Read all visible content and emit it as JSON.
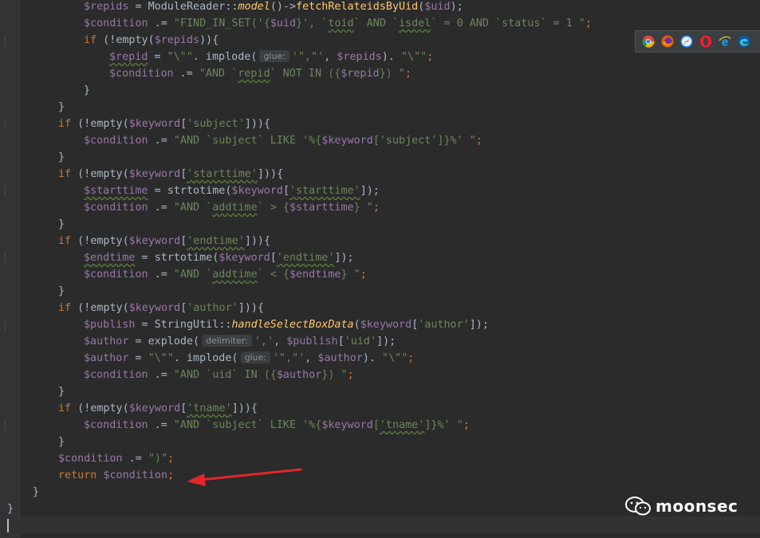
{
  "code": {
    "l1": {
      "var": "$repids",
      "eq": " = ",
      "cls": "ModuleReader",
      "dc": "::",
      "mfn": "model",
      "after": "()->",
      "fn": "fetchRelateidsByUid",
      "o": "(",
      "arg": "$uid",
      "end": ");"
    },
    "l2": {
      "var": "$condition",
      "op": " .= ",
      "s1": "\"FIND_IN_SET('{",
      "v1": "$uid",
      "s2": "}', `",
      "w1": "toid",
      "s3": "` AND `",
      "w2": "isdel",
      "s4": "` = 0 AND `status` = 1 \"",
      "end": ";"
    },
    "l3": {
      "kw": "if",
      "a": " (!",
      "fn": "empty",
      "b": "(",
      "var": "$repids",
      "c": ")){"
    },
    "l4": {
      "var": "$repid",
      "eq": " = ",
      "s1": "\"\\\"\"",
      "dot": ". implode(",
      "hint": "glue:",
      "s2": "'\",\"'",
      "comma": ", ",
      "v2": "$repids",
      "close": "). ",
      "s3": "\"\\\"\"",
      "end": ";"
    },
    "l5": {
      "var": "$condition",
      "op": " .= ",
      "s1": "\"AND `",
      "w1": "repid",
      "s2": "` NOT IN ({",
      "v1": "$repid",
      "s3": "}) \"",
      "end": ";"
    },
    "l6": {
      "brace": "}"
    },
    "l7": {
      "brace": "}"
    },
    "l8": {
      "kw": "if",
      "a": " (!",
      "fn": "empty",
      "b": "(",
      "var": "$keyword",
      "c": "[",
      "key": "'subject'",
      "d": "])){"
    },
    "l9": {
      "var": "$condition",
      "op": " .= ",
      "s1": "\"AND `subject` LIKE '%{",
      "v1": "$keyword",
      "s2": "[",
      "s3": "'subject'",
      "s4": "]}%' \"",
      "end": ";"
    },
    "l10": {
      "brace": "}"
    },
    "l11": {
      "kw": "if",
      "a": " (!",
      "fn": "empty",
      "b": "(",
      "var": "$keyword",
      "c": "[",
      "key": "'starttime'",
      "d": "])){"
    },
    "l12": {
      "var": "$starttime",
      "eq": " = ",
      "fn": "strtotime",
      "o": "(",
      "v2": "$keyword",
      "c": "[",
      "key": "'starttime'",
      "end": "]);"
    },
    "l13": {
      "var": "$condition",
      "op": " .= ",
      "s1": "\"AND `",
      "w1": "addtime",
      "s2": "` > {",
      "v1": "$starttime",
      "s3": "} \"",
      "end": ";"
    },
    "l14": {
      "brace": "}"
    },
    "l15": {
      "kw": "if",
      "a": " (!",
      "fn": "empty",
      "b": "(",
      "var": "$keyword",
      "c": "[",
      "key": "'endtime'",
      "d": "])){"
    },
    "l16": {
      "var": "$endtime",
      "eq": " = ",
      "fn": "strtotime",
      "o": "(",
      "v2": "$keyword",
      "c": "[",
      "key": "'endtime'",
      "end": "]);"
    },
    "l17": {
      "var": "$condition",
      "op": " .= ",
      "s1": "\"AND `",
      "w1": "addtime",
      "s2": "` < {",
      "v1": "$endtime",
      "s3": "} \"",
      "end": ";"
    },
    "l18": {
      "brace": "}"
    },
    "l19": {
      "kw": "if",
      "a": " (!",
      "fn": "empty",
      "b": "(",
      "var": "$keyword",
      "c": "[",
      "key": "'author'",
      "d": "])){"
    },
    "l20": {
      "var": "$publish",
      "eq": " = ",
      "cls": "StringUtil",
      "dc": "::",
      "mfn": "handleSelectBoxData",
      "o": "(",
      "v2": "$keyword",
      "c": "[",
      "key": "'author'",
      "end": "]);"
    },
    "l21": {
      "var": "$author",
      "eq": " = ",
      "fn": "explode(",
      "hint": "delimiter:",
      "s1": "','",
      "comma": ", ",
      "v2": "$publish",
      "c": "[",
      "key": "'uid'",
      "end": "]);"
    },
    "l22": {
      "var": "$author",
      "eq": " = ",
      "s1": "\"\\\"\"",
      "dot": ". implode(",
      "hint": "glue:",
      "s2": "'\",\"'",
      "comma": ", ",
      "v2": "$author",
      "close": "). ",
      "s3": "\"\\\"\"",
      "end": ";"
    },
    "l23": {
      "var": "$condition",
      "op": " .= ",
      "s1": "\"AND `uid` IN ({",
      "v1": "$author",
      "s2": "}) \"",
      "end": ";"
    },
    "l24": {
      "brace": "}"
    },
    "l25": {
      "kw": "if",
      "a": " (!",
      "fn": "empty",
      "b": "(",
      "var": "$keyword",
      "c": "[",
      "key": "'tname'",
      "d": "])){"
    },
    "l26": {
      "var": "$condition",
      "op": " .= ",
      "s1": "\"AND `subject` LIKE '%{",
      "v1": "$keyword",
      "s2": "[",
      "s3": "'tname'",
      "s4": "]}%' \"",
      "end": ";"
    },
    "l27": {
      "brace": "}"
    },
    "l28": {
      "var": "$condition",
      "op": " .= ",
      "s1": "\")\"",
      "end": ";"
    },
    "l29": {
      "kw": "return",
      "sp": " ",
      "var": "$condition",
      "end": ";"
    },
    "l30": {
      "brace": "}"
    },
    "l31": {
      "brace": "}"
    }
  },
  "browsers": [
    "chrome-icon",
    "firefox-icon",
    "safari-icon",
    "opera-icon",
    "ie-icon",
    "edge-icon"
  ],
  "watermark": {
    "text": "moonsec"
  },
  "colors": {
    "background": "#2b2b2b",
    "keyword": "#cc7832",
    "variable": "#9876aa",
    "string": "#6a8759",
    "function": "#ffc66d",
    "arrow": "#e0262b"
  }
}
